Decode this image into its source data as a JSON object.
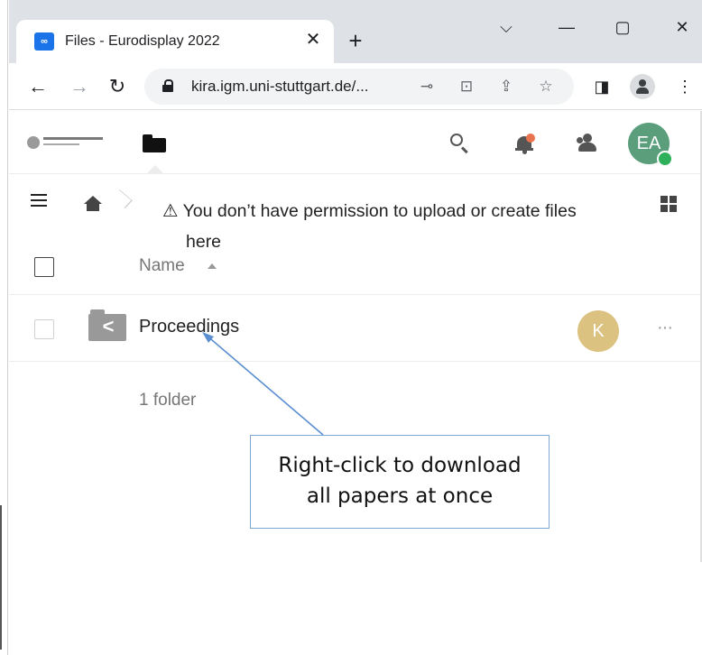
{
  "browser": {
    "tab_title": "Files - Eurodisplay 2022",
    "tab_favicon": "nextcloud-icon",
    "tab_close": "✕",
    "new_tab": "+",
    "window_controls": {
      "dropdown": "⌵",
      "minimize": "—",
      "maximize": "▢",
      "close": "✕"
    },
    "url": "kira.igm.uni-stuttgart.de/...",
    "icons": [
      "back-icon",
      "forward-icon",
      "reload-icon",
      "lock-icon",
      "key-icon",
      "translate-icon",
      "share-icon",
      "star-icon",
      "side-panel-icon",
      "profile-icon",
      "menu-icon"
    ]
  },
  "app": {
    "logo": "university-of-stuttgart-logo",
    "nav_icons": [
      "files-icon",
      "search-icon",
      "notifications-icon",
      "contacts-icon"
    ],
    "user_avatar": "EA",
    "status_color": "#2fb15c",
    "notification_color": "#e9734f"
  },
  "breadcrumb": {
    "warning_icon": "⚠",
    "warning_line1": "You don’t have permission to upload or create files",
    "warning_line2": "here"
  },
  "table": {
    "column_name": "Name",
    "rows": [
      {
        "name": "Proceedings",
        "type": "shared-folder",
        "owner_avatar": "K",
        "more": "···"
      }
    ],
    "summary": "1 folder"
  },
  "annotation": {
    "line1": "Right-click to download",
    "line2": "all papers at once"
  }
}
